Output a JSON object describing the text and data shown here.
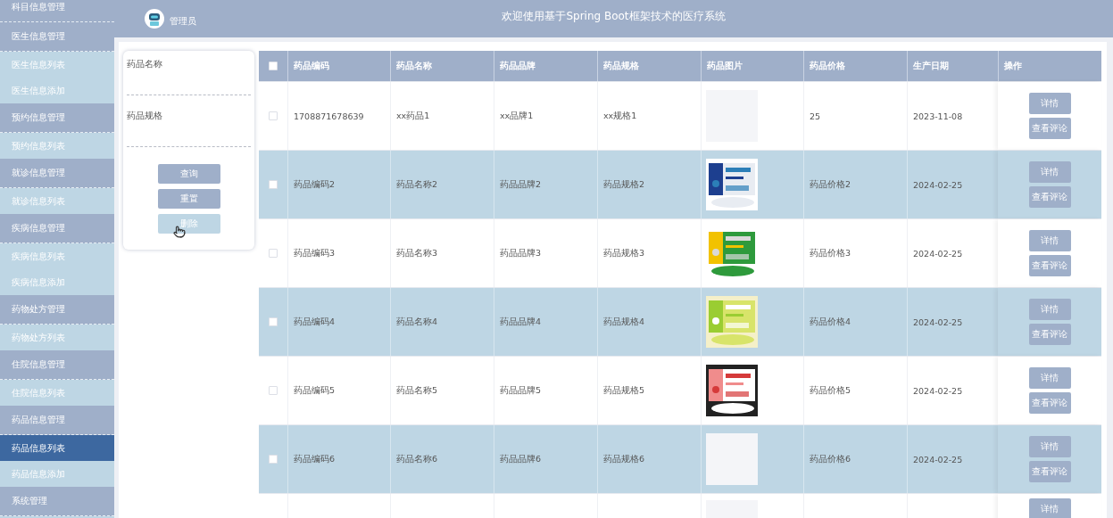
{
  "sidebar": {
    "groups": [
      {
        "label": "科目信息管理"
      },
      {
        "label": "医生信息管理",
        "children": [
          {
            "label": "医生信息列表",
            "selected": false
          },
          {
            "label": "医生信息添加",
            "selected": false
          }
        ]
      },
      {
        "label": "预约信息管理",
        "children": [
          {
            "label": "预约信息列表",
            "selected": false
          }
        ]
      },
      {
        "label": "就诊信息管理",
        "children": [
          {
            "label": "就诊信息列表",
            "selected": false
          }
        ]
      },
      {
        "label": "疾病信息管理",
        "children": [
          {
            "label": "疾病信息列表",
            "selected": false
          },
          {
            "label": "疾病信息添加",
            "selected": false
          }
        ]
      },
      {
        "label": "药物处方管理",
        "children": [
          {
            "label": "药物处方列表",
            "selected": false
          }
        ]
      },
      {
        "label": "住院信息管理",
        "children": [
          {
            "label": "住院信息列表",
            "selected": false
          }
        ]
      },
      {
        "label": "药品信息管理",
        "children": [
          {
            "label": "药品信息列表",
            "selected": true
          },
          {
            "label": "药品信息添加",
            "selected": false
          }
        ]
      },
      {
        "label": "系统管理"
      }
    ]
  },
  "header": {
    "user": "管理员",
    "title": "欢迎使用基于Spring Boot框架技术的医疗系统"
  },
  "search": {
    "fields": [
      {
        "label": "药品名称"
      },
      {
        "label": "药品规格"
      }
    ],
    "buttons": [
      {
        "label": "查询",
        "disabled": false
      },
      {
        "label": "重置",
        "disabled": false
      },
      {
        "label": "删除",
        "disabled": true
      }
    ]
  },
  "table": {
    "columns": [
      "药品编码",
      "药品名称",
      "药品品牌",
      "药品规格",
      "药品图片",
      "药品价格",
      "生产日期",
      "操作"
    ],
    "select_all": {
      "checked": false
    },
    "rows": [
      {
        "checked": false,
        "code": "1708871678639",
        "name": "xx药品1",
        "brand": "xx品牌1",
        "spec": "xx规格1",
        "image": {
          "kind": "blank"
        },
        "price": "25",
        "date": "2023-11-08",
        "actions": [
          "详情",
          "查看评论"
        ]
      },
      {
        "checked": false,
        "code": "药品编码2",
        "name": "药品名称2",
        "brand": "药品品牌2",
        "spec": "药品规格2",
        "image": {
          "kind": "picture"
        },
        "price": "药品价格2",
        "date": "2024-02-25",
        "actions": [
          "详情",
          "查看评论"
        ]
      },
      {
        "checked": false,
        "code": "药品编码3",
        "name": "药品名称3",
        "brand": "药品品牌3",
        "spec": "药品规格3",
        "image": {
          "kind": "picture"
        },
        "price": "药品价格3",
        "date": "2024-02-25",
        "actions": [
          "详情",
          "查看评论"
        ]
      },
      {
        "checked": false,
        "code": "药品编码4",
        "name": "药品名称4",
        "brand": "药品品牌4",
        "spec": "药品规格4",
        "image": {
          "kind": "picture"
        },
        "price": "药品价格4",
        "date": "2024-02-25",
        "actions": [
          "详情",
          "查看评论"
        ]
      },
      {
        "checked": false,
        "code": "药品编码5",
        "name": "药品名称5",
        "brand": "药品品牌5",
        "spec": "药品规格5",
        "image": {
          "kind": "picture"
        },
        "price": "药品价格5",
        "date": "2024-02-25",
        "actions": [
          "详情",
          "查看评论"
        ]
      },
      {
        "checked": false,
        "code": "药品编码6",
        "name": "药品名称6",
        "brand": "药品品牌6",
        "spec": "药品规格6",
        "image": {
          "kind": "blank"
        },
        "price": "药品价格6",
        "date": "2024-02-25",
        "actions": [
          "详情",
          "查看评论"
        ]
      },
      {
        "image": {
          "kind": "blank"
        },
        "actions": [
          "详情"
        ]
      }
    ]
  }
}
